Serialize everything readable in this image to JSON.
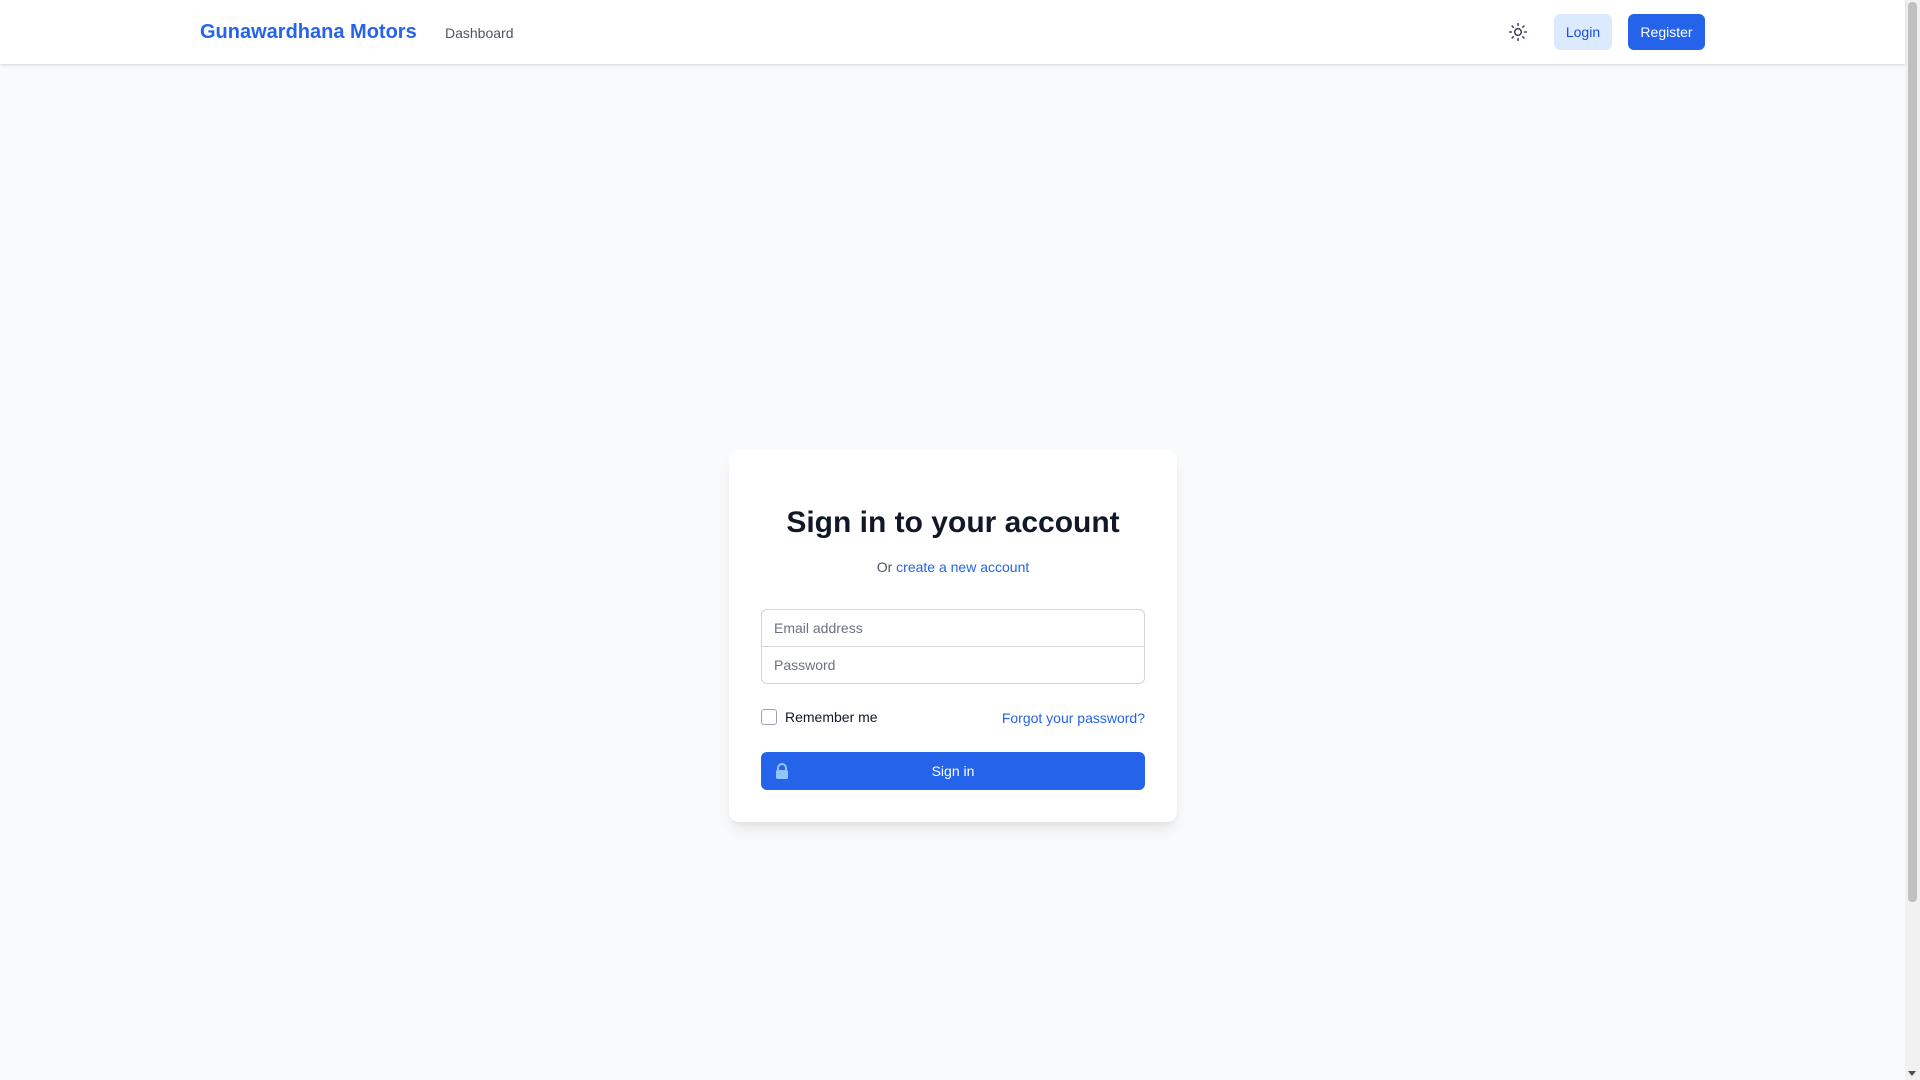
{
  "navbar": {
    "brand": "Gunawardhana Motors",
    "links": [
      {
        "label": "Dashboard"
      }
    ],
    "theme_icon": "sun-icon",
    "login_label": "Login",
    "register_label": "Register"
  },
  "signin": {
    "title": "Sign in to your account",
    "subtitle_prefix": "Or",
    "create_account_link": "create a new account",
    "email_placeholder": "Email address",
    "password_placeholder": "Password",
    "remember_label": "Remember me",
    "forgot_link": "Forgot your password?",
    "submit_label": "Sign in",
    "submit_icon": "lock-icon"
  },
  "colors": {
    "primary": "#2563eb",
    "primary_light": "#dbeafe",
    "background": "#f9fafb",
    "card": "#ffffff",
    "text": "#111827",
    "muted": "#4b5563"
  }
}
